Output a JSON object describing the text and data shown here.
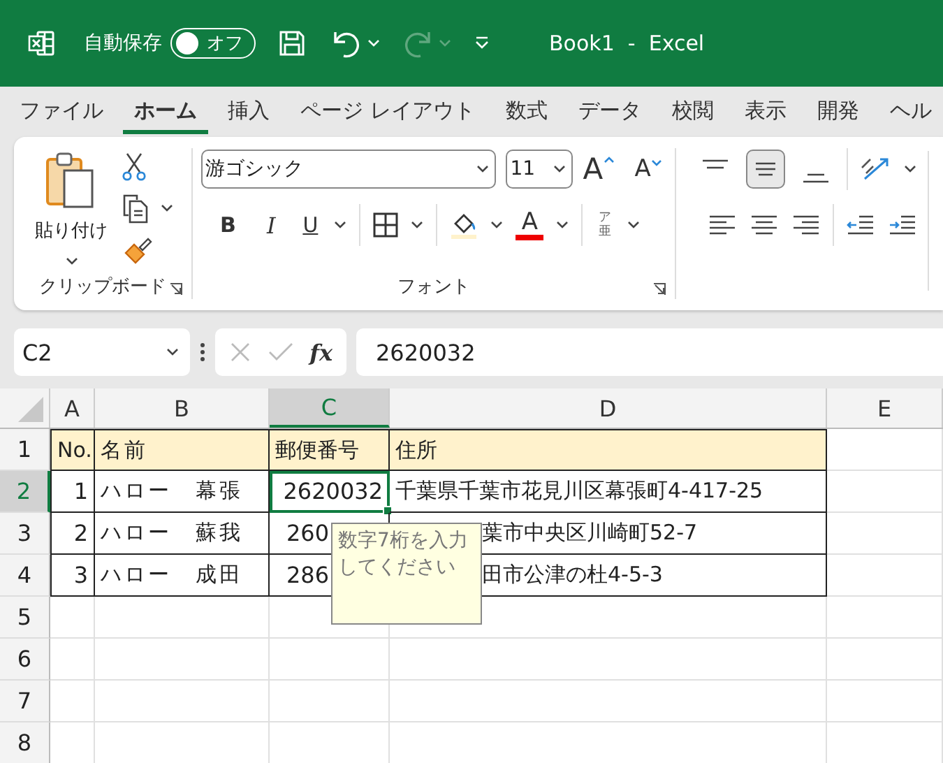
{
  "title_bar": {
    "autosave_label": "自動保存",
    "autosave": {
      "on": false,
      "label": "オフ"
    },
    "quick_access": [
      {
        "kind": "save",
        "disabled": false
      },
      {
        "kind": "undo",
        "disabled": false
      },
      {
        "kind": "redo",
        "disabled": true
      },
      {
        "kind": "customize",
        "disabled": false
      }
    ],
    "title": "Book1  -  Excel"
  },
  "menu_tabs": [
    {
      "label": "ファイル",
      "selected": false
    },
    {
      "label": "ホーム",
      "selected": true
    },
    {
      "label": "挿入",
      "selected": false
    },
    {
      "label": "ページ レイアウト",
      "selected": false
    },
    {
      "label": "数式",
      "selected": false
    },
    {
      "label": "データ",
      "selected": false
    },
    {
      "label": "校閲",
      "selected": false
    },
    {
      "label": "表示",
      "selected": false
    },
    {
      "label": "開発",
      "selected": false
    },
    {
      "label": "ヘル",
      "selected": false
    }
  ],
  "ribbon": {
    "clipboard": {
      "paste_label": "貼り付け",
      "group_label": "クリップボード"
    },
    "font": {
      "font_name": "游ゴシック",
      "font_size": "11",
      "grow": "A",
      "shrink": "A",
      "bold": "B",
      "italic": "I",
      "underline": "U",
      "font_color": "A",
      "phonetic": [
        "ア",
        "亜"
      ],
      "group_label": "フォント"
    },
    "alignment": {
      "vertical": [
        {
          "kind": "top",
          "selected": false
        },
        {
          "kind": "middle",
          "selected": true
        },
        {
          "kind": "bottom",
          "selected": false
        }
      ]
    }
  },
  "formula_bar": {
    "name_box": "C2",
    "fx": "fx",
    "formula": "2620032"
  },
  "sheet": {
    "columns": [
      {
        "label": "A",
        "selected": false
      },
      {
        "label": "B",
        "selected": false
      },
      {
        "label": "C",
        "selected": true
      },
      {
        "label": "D",
        "selected": false
      },
      {
        "label": "E",
        "selected": false
      }
    ],
    "rows": [
      {
        "header": "1",
        "selected": false,
        "cells": [
          {
            "text": "No.",
            "kind": "text",
            "selected": false
          },
          {
            "text": "名前",
            "kind": "text",
            "selected": false
          },
          {
            "text": "郵便番号",
            "kind": "text",
            "selected": false
          },
          {
            "text": "住所",
            "kind": "text",
            "selected": false
          }
        ]
      },
      {
        "header": "2",
        "selected": true,
        "cells": [
          {
            "text": "1",
            "kind": "number",
            "selected": false
          },
          {
            "text": "ハロー　幕張",
            "kind": "text",
            "selected": false
          },
          {
            "text": "2620032",
            "kind": "number",
            "selected": true
          },
          {
            "text": "千葉県千葉市花見川区幕張町4-417-25",
            "kind": "text",
            "selected": false
          }
        ]
      },
      {
        "header": "3",
        "selected": false,
        "cells": [
          {
            "text": "2",
            "kind": "number",
            "selected": false
          },
          {
            "text": "ハロー　蘇我",
            "kind": "text",
            "selected": false
          },
          {
            "text": "260",
            "kind": "partial",
            "selected": false
          },
          {
            "text": "葉市中央区川崎町52-7",
            "kind": "partial",
            "selected": false
          }
        ]
      },
      {
        "header": "4",
        "selected": false,
        "cells": [
          {
            "text": "3",
            "kind": "number",
            "selected": false
          },
          {
            "text": "ハロー　成田",
            "kind": "text",
            "selected": false
          },
          {
            "text": "286",
            "kind": "partial",
            "selected": false
          },
          {
            "text": "田市公津の杜4-5-3",
            "kind": "partial",
            "selected": false
          }
        ]
      },
      {
        "header": "5",
        "selected": false
      },
      {
        "header": "6",
        "selected": false
      },
      {
        "header": "7",
        "selected": false
      },
      {
        "header": "8",
        "selected": false
      }
    ],
    "tooltip": "数字7桁を入力してください"
  }
}
